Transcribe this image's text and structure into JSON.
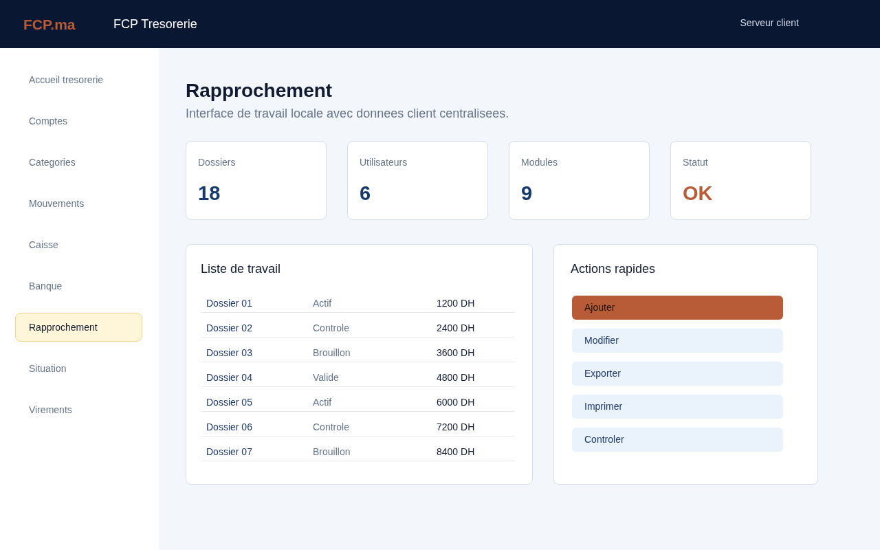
{
  "header": {
    "logo": "FCP.ma",
    "app_title": "FCP Tresorerie",
    "server_label": "Serveur client"
  },
  "sidebar": {
    "items": [
      {
        "label": "Accueil tresorerie",
        "selected": false
      },
      {
        "label": "Comptes",
        "selected": false
      },
      {
        "label": "Categories",
        "selected": false
      },
      {
        "label": "Mouvements",
        "selected": false
      },
      {
        "label": "Caisse",
        "selected": false
      },
      {
        "label": "Banque",
        "selected": false
      },
      {
        "label": "Rapprochement",
        "selected": true
      },
      {
        "label": "Situation",
        "selected": false
      },
      {
        "label": "Virements",
        "selected": false
      }
    ]
  },
  "page": {
    "title": "Rapprochement",
    "subtitle": "Interface de travail locale avec donnees client centralisees."
  },
  "stats": [
    {
      "label": "Dossiers",
      "value": "18",
      "kind": "count"
    },
    {
      "label": "Utilisateurs",
      "value": "6",
      "kind": "count"
    },
    {
      "label": "Modules",
      "value": "9",
      "kind": "count"
    },
    {
      "label": "Statut",
      "value": "OK",
      "kind": "status"
    }
  ],
  "work_list": {
    "title": "Liste de travail",
    "rows": [
      {
        "dossier": "Dossier 01",
        "status": "Actif",
        "amount": "1200 DH"
      },
      {
        "dossier": "Dossier 02",
        "status": "Controle",
        "amount": "2400 DH"
      },
      {
        "dossier": "Dossier 03",
        "status": "Brouillon",
        "amount": "3600 DH"
      },
      {
        "dossier": "Dossier 04",
        "status": "Valide",
        "amount": "4800 DH"
      },
      {
        "dossier": "Dossier 05",
        "status": "Actif",
        "amount": "6000 DH"
      },
      {
        "dossier": "Dossier 06",
        "status": "Controle",
        "amount": "7200 DH"
      },
      {
        "dossier": "Dossier 07",
        "status": "Brouillon",
        "amount": "8400 DH"
      }
    ]
  },
  "quick_actions": {
    "title": "Actions rapides",
    "buttons": [
      {
        "label": "Ajouter",
        "selected": true
      },
      {
        "label": "Modifier",
        "selected": false
      },
      {
        "label": "Exporter",
        "selected": false
      },
      {
        "label": "Imprimer",
        "selected": false
      },
      {
        "label": "Controler",
        "selected": false
      }
    ]
  }
}
